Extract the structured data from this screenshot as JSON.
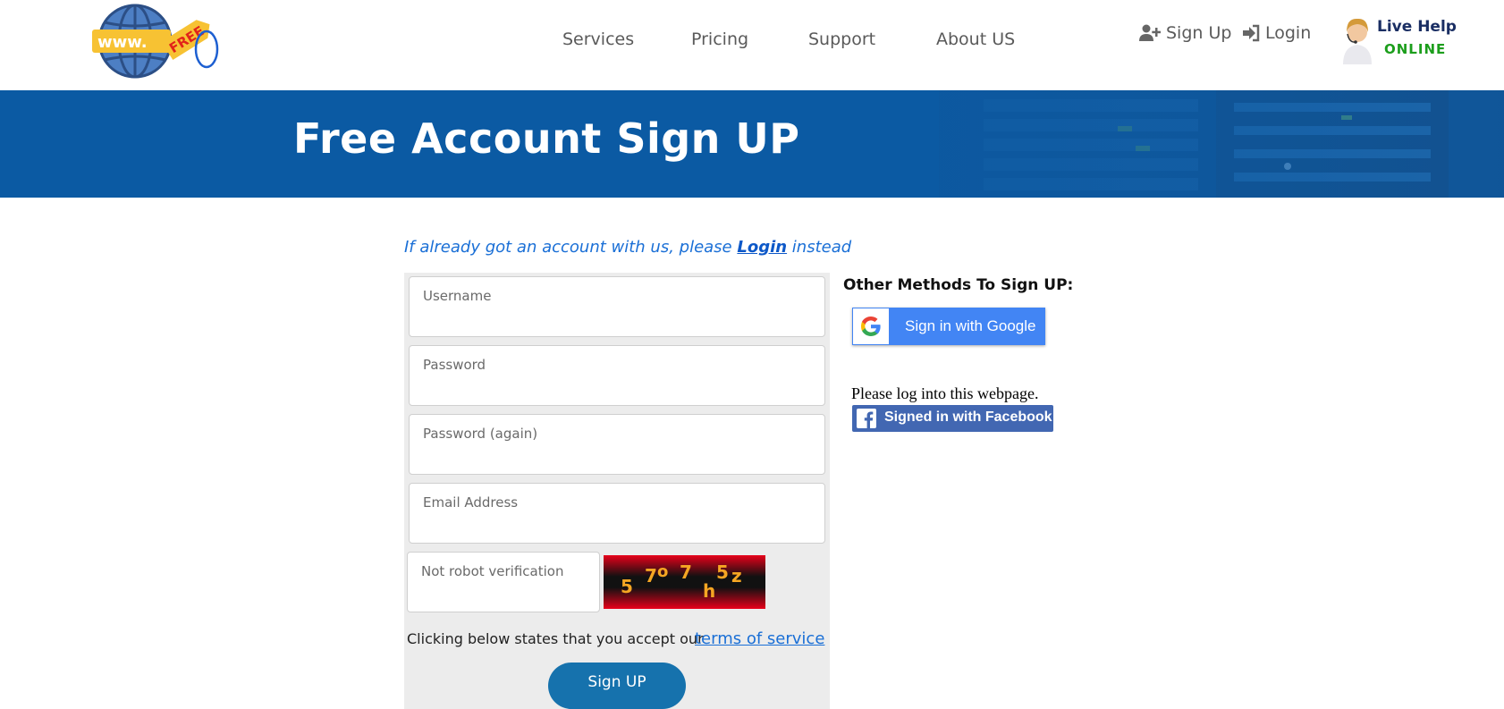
{
  "header": {
    "logo_text": "www.",
    "logo_tag_text": "FREE",
    "nav": [
      {
        "label": "Services"
      },
      {
        "label": "Pricing"
      },
      {
        "label": "Support"
      },
      {
        "label": "About US"
      }
    ],
    "signup_label": "Sign Up",
    "login_label": "Login",
    "live_help": {
      "line1": "Live Help",
      "line2": "ONLINE"
    }
  },
  "banner": {
    "title": "Free Account Sign UP"
  },
  "form": {
    "login_hint_prefix": "If already got an account with us, please ",
    "login_hint_link": "Login",
    "login_hint_suffix": " instead",
    "fields": [
      {
        "label": "Username",
        "value": ""
      },
      {
        "label": "Password",
        "value": ""
      },
      {
        "label": "Password (again)",
        "value": ""
      },
      {
        "label": "Email Address",
        "value": ""
      }
    ],
    "captcha_label": "Not robot verification",
    "captcha_chars": [
      "5",
      "7",
      "o",
      "7",
      "h",
      "5",
      "z"
    ],
    "terms_text": "Clicking below states that you accept our",
    "terms_link": "terms of service",
    "submit_label": "Sign UP"
  },
  "other_methods": {
    "title": "Other Methods To Sign UP:",
    "google_label": "Sign in with Google",
    "facebook_note": "Please log into this webpage.",
    "facebook_label": "Signed in with Facebook"
  },
  "colors": {
    "banner": "#0b5aa3",
    "link": "#1a6fd6",
    "submit": "#1672ad",
    "google": "#4285f4",
    "facebook": "#4267b2"
  }
}
